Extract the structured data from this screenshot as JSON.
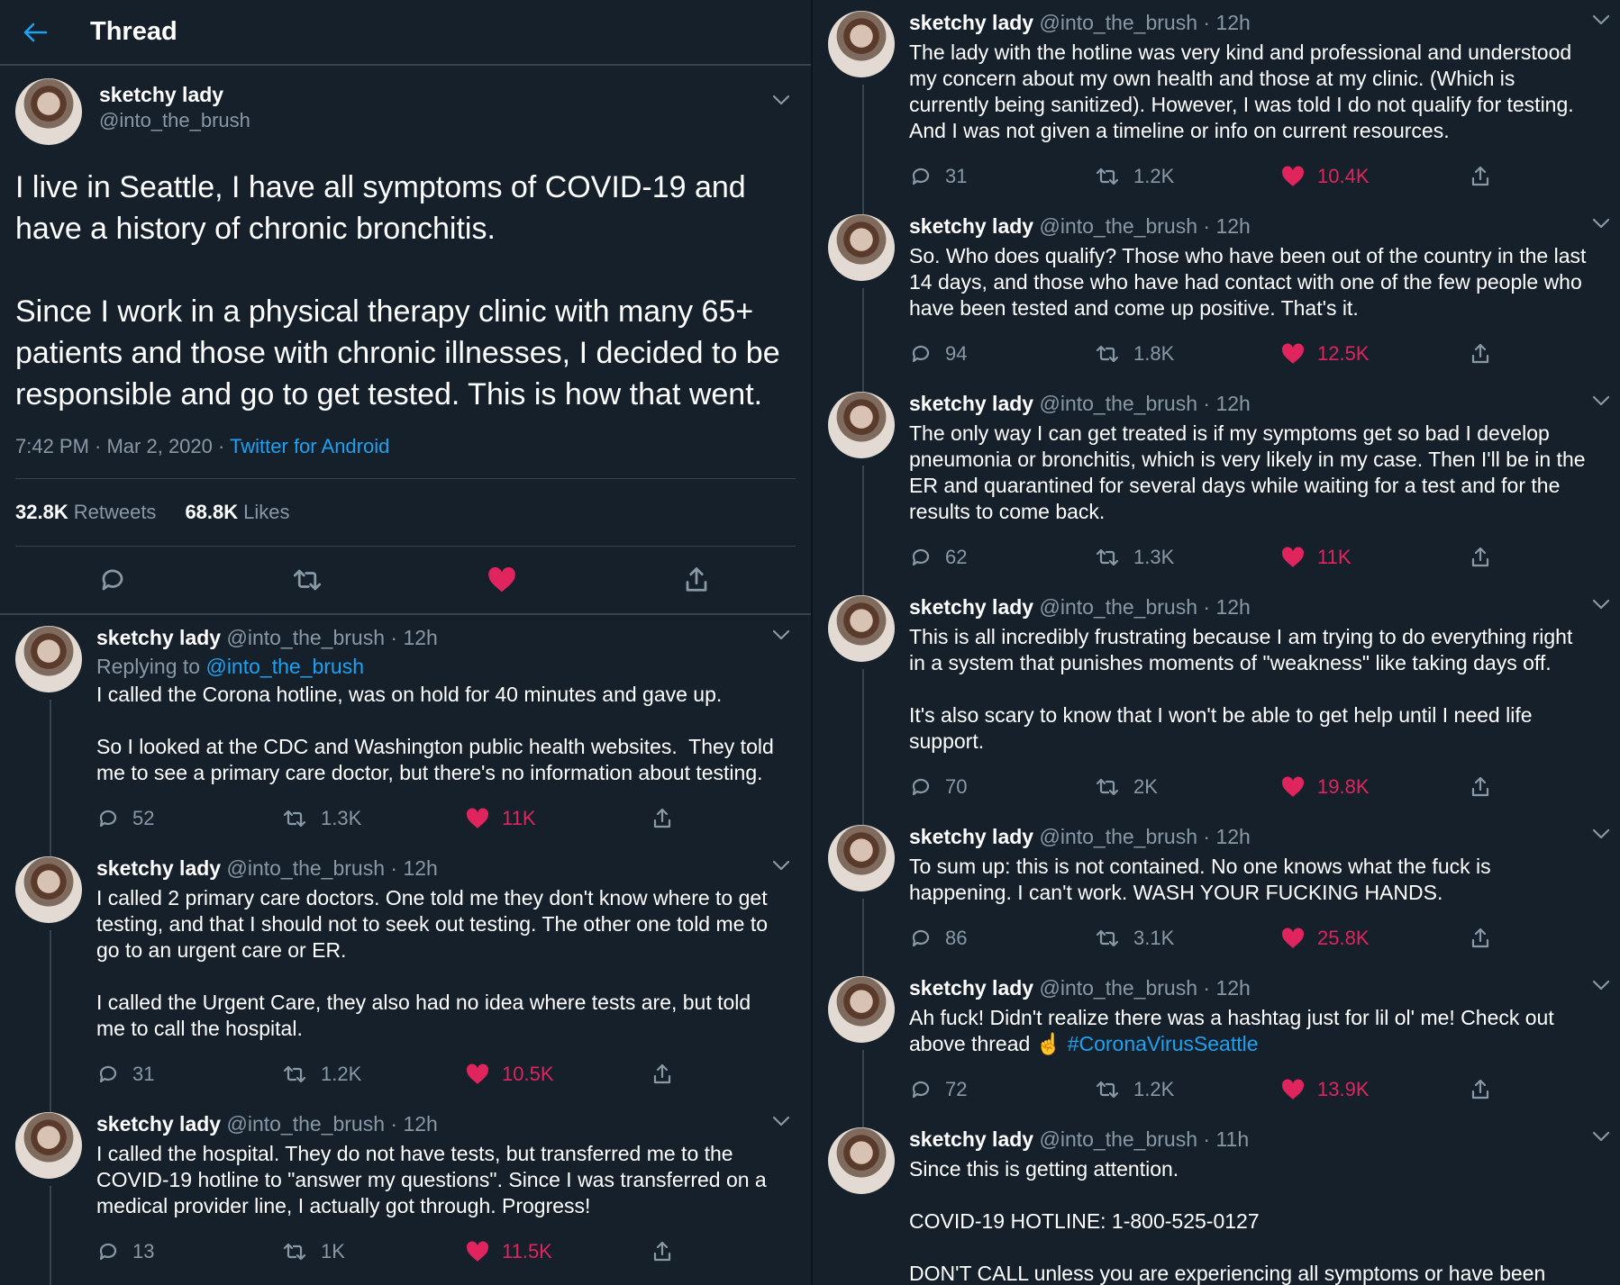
{
  "header": {
    "title": "Thread"
  },
  "colors": {
    "background": "#15202b",
    "accent": "#1da1f2",
    "like": "#e0245e",
    "muted": "#8899a6"
  },
  "main_tweet": {
    "name": "sketchy lady",
    "handle": "@into_the_brush",
    "text": "I live in Seattle, I have all symptoms of COVID-19 and have a history of chronic bronchitis.\n\nSince I work in a physical therapy clinic with many 65+ patients and those with chronic illnesses, I decided to be responsible and go to get tested. This is how that went.",
    "time": "7:42 PM · Mar 2, 2020 · ",
    "source": "Twitter for Android",
    "retweets_count": "32.8K",
    "retweets_label": "Retweets",
    "likes_count": "68.8K",
    "likes_label": "Likes"
  },
  "left_replies": [
    {
      "name": "sketchy lady",
      "handle": "@into_the_brush",
      "time": " · 12h",
      "replying_prefix": "Replying to ",
      "replying_to": "@into_the_brush",
      "text": "I called the Corona hotline, was on hold for 40 minutes and gave up.\n\nSo I looked at the CDC and Washington public health websites.  They told me to see a primary care doctor, but there's no information about testing.",
      "replies": "52",
      "retweets": "1.3K",
      "likes": "11K"
    },
    {
      "name": "sketchy lady",
      "handle": "@into_the_brush",
      "time": " · 12h",
      "text": "I called 2 primary care doctors. One told me they don't know where to get testing, and that I should not to seek out testing. The other one told me to go to an urgent care or ER.\n\nI called the Urgent Care, they also had no idea where tests are, but told me to call the hospital.",
      "replies": "31",
      "retweets": "1.2K",
      "likes": "10.5K"
    },
    {
      "name": "sketchy lady",
      "handle": "@into_the_brush",
      "time": " · 12h",
      "text": "I called the hospital. They do not have tests, but transferred me to the COVID-19 hotline to \"answer my questions\". Since I was transferred on a medical provider line, I actually got through. Progress!",
      "replies": "13",
      "retweets": "1K",
      "likes": "11.5K"
    }
  ],
  "right_replies": [
    {
      "name": "sketchy lady",
      "handle": "@into_the_brush",
      "time": " · 12h",
      "text": "The lady with the hotline was very kind and professional and understood my concern about my own health and those at my clinic. (Which is currently being sanitized). However, I was told I do not qualify for testing. And I was not given a timeline or info on current resources.",
      "replies": "31",
      "retweets": "1.2K",
      "likes": "10.4K"
    },
    {
      "name": "sketchy lady",
      "handle": "@into_the_brush",
      "time": " · 12h",
      "text": "So. Who does qualify? Those who have been out of the country in the last 14 days, and those who have had contact with one of the few people who have been tested and come up positive. That's it.",
      "replies": "94",
      "retweets": "1.8K",
      "likes": "12.5K"
    },
    {
      "name": "sketchy lady",
      "handle": "@into_the_brush",
      "time": " · 12h",
      "text": "The only way I can get treated is if my symptoms get so bad I develop pneumonia or bronchitis, which is very likely in my case. Then I'll be in the ER and quarantined for several days while waiting for a test and for the results to come back.",
      "replies": "62",
      "retweets": "1.3K",
      "likes": "11K"
    },
    {
      "name": "sketchy lady",
      "handle": "@into_the_brush",
      "time": " · 12h",
      "text": "This is all incredibly frustrating because I am trying to do everything right in a system that punishes moments of \"weakness\" like taking days off.\n\nIt's also scary to know that I won't be able to get help until I need life support.",
      "replies": "70",
      "retweets": "2K",
      "likes": "19.8K"
    },
    {
      "name": "sketchy lady",
      "handle": "@into_the_brush",
      "time": " · 12h",
      "text": "To sum up: this is not contained. No one knows what the fuck is happening. I can't work. WASH YOUR FUCKING HANDS.",
      "replies": "86",
      "retweets": "3.1K",
      "likes": "25.8K"
    },
    {
      "name": "sketchy lady",
      "handle": "@into_the_brush",
      "time": " · 12h",
      "text": "Ah fuck! Didn't realize there was a hashtag just for lil ol' me! Check out above thread ☝️ ",
      "hashtag": "#CoronaVirusSeattle",
      "replies": "72",
      "retweets": "1.2K",
      "likes": "13.9K"
    },
    {
      "name": "sketchy lady",
      "handle": "@into_the_brush",
      "time": " · 11h",
      "text": "Since this is getting attention.\n\nCOVID-19 HOTLINE: 1-800-525-0127\n\nDON'T CALL unless you are experiencing all symptoms or have been exposed to a case. I leave the lines open to people who need it most. Any"
    }
  ]
}
